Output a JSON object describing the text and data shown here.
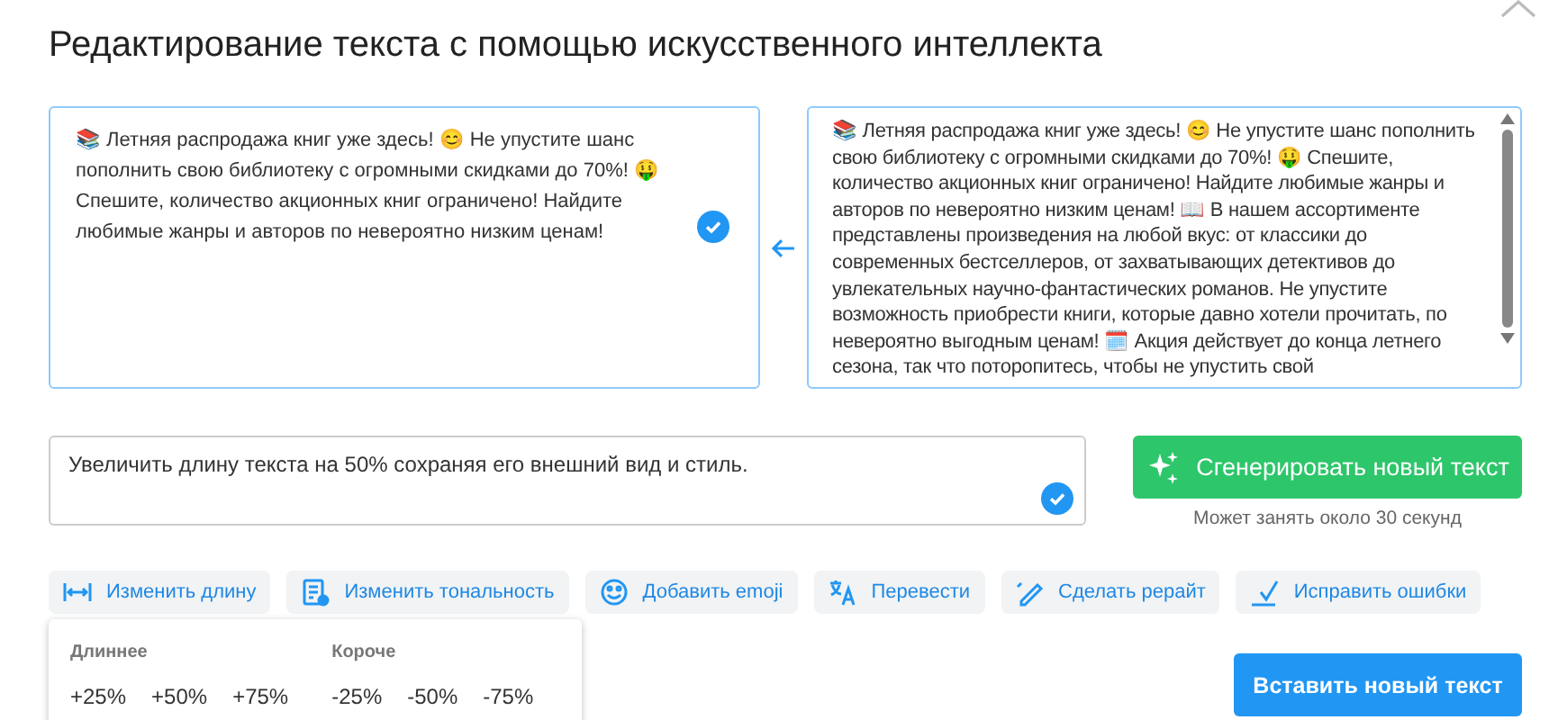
{
  "title": "Редактирование текста с помощью искусственного интеллекта",
  "original_text": "📚 Летняя распродажа книг уже здесь! 😊 Не упустите шанс пополнить свою библиотеку с огромными скидками до 70%! 🤑 Спешите, количество акционных книг ограничено! Найдите любимые жанры и авторов по невероятно низким ценам!",
  "new_text": "📚 Летняя распродажа книг уже здесь! 😊 Не упустите шанс пополнить свою библиотеку с огромными скидками до 70%! 🤑 Спешите, количество акционных книг ограничено! Найдите любимые жанры и авторов по невероятно низким ценам! 📖 В нашем ассортименте представлены произведения на любой вкус: от классики до современных бестселлеров, от захватывающих детективов до увлекательных научно-фантастических романов. Не упустите возможность приобрести книги, которые давно хотели прочитать, по невероятно выгодным ценам! 🗓️ Акция действует до конца летнего сезона, так что поторопитесь, чтобы не упустить свой",
  "prompt": "Увеличить длину текста на 50% сохраняя его внешний вид и стиль.",
  "generate_button": "Сгенерировать новый текст",
  "generate_hint": "Может занять около 30 секунд",
  "tools": [
    {
      "label": "Изменить длину",
      "kind": "length"
    },
    {
      "label": "Изменить тональность",
      "kind": "tone"
    },
    {
      "label": "Добавить emoji",
      "kind": "emoji"
    },
    {
      "label": "Перевести",
      "kind": "translate"
    },
    {
      "label": "Сделать рерайт",
      "kind": "rewrite"
    },
    {
      "label": "Исправить ошибки",
      "kind": "fix"
    }
  ],
  "length_menu": {
    "groups": [
      {
        "heading": "Длиннее",
        "options": [
          "+25%",
          "+50%",
          "+75%"
        ]
      },
      {
        "heading": "Короче",
        "options": [
          "-25%",
          "-50%",
          "-75%"
        ]
      }
    ]
  },
  "insert_button": "Вставить новый текст"
}
